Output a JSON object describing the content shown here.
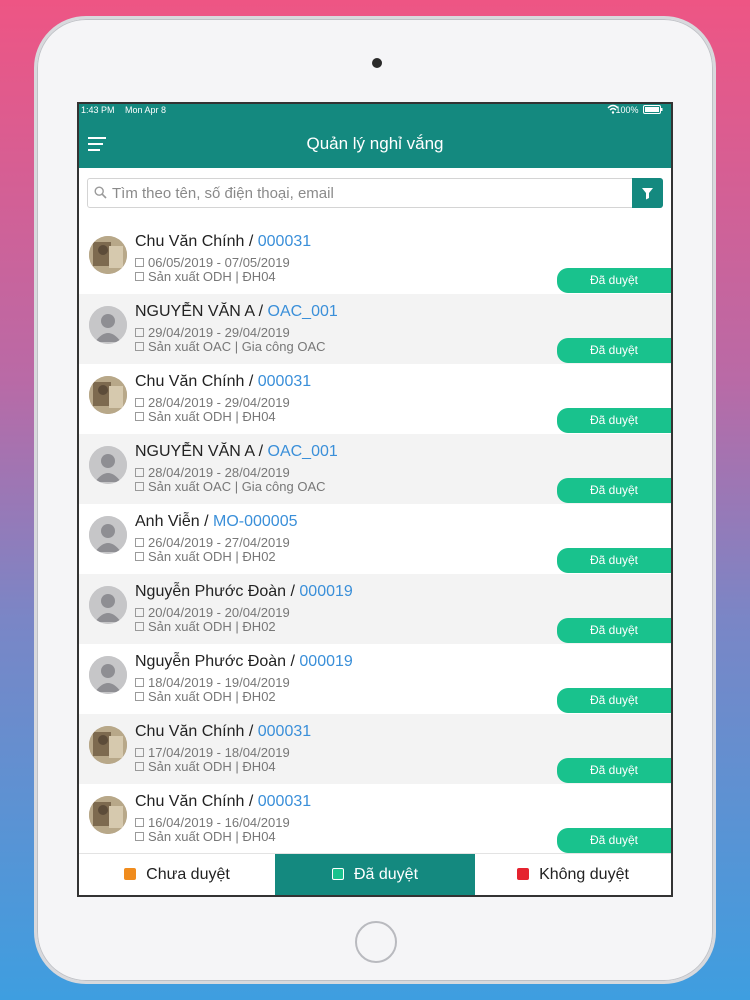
{
  "status_bar": {
    "time": "1:43 PM",
    "date": "Mon Apr 8",
    "battery": "100%"
  },
  "header": {
    "title": "Quản lý nghỉ vắng"
  },
  "search": {
    "placeholder": "Tìm theo tên, số điện thoại, email"
  },
  "leaves": [
    {
      "name": "Chu Văn Chính",
      "code": "000031",
      "dates": "06/05/2019 - 07/05/2019",
      "dept": "Sản xuất ODH | ĐH04",
      "status": "Đã duyệt",
      "avatar": "photo"
    },
    {
      "name": "NGUYỄN VĂN A",
      "code": "OAC_001",
      "dates": "29/04/2019 - 29/04/2019",
      "dept": "Sản xuất OAC | Gia công OAC",
      "status": "Đã duyệt",
      "avatar": "default"
    },
    {
      "name": "Chu Văn Chính",
      "code": "000031",
      "dates": "28/04/2019 - 29/04/2019",
      "dept": "Sản xuất ODH | ĐH04",
      "status": "Đã duyệt",
      "avatar": "photo"
    },
    {
      "name": "NGUYỄN VĂN A",
      "code": "OAC_001",
      "dates": "28/04/2019 - 28/04/2019",
      "dept": "Sản xuất OAC | Gia công OAC",
      "status": "Đã duyệt",
      "avatar": "default"
    },
    {
      "name": "Anh Viễn",
      "code": "MO-000005",
      "dates": "26/04/2019 - 27/04/2019",
      "dept": "Sản xuất ODH | ĐH02",
      "status": "Đã duyệt",
      "avatar": "default"
    },
    {
      "name": "Nguyễn Phước Đoàn",
      "code": "000019",
      "dates": "20/04/2019 - 20/04/2019",
      "dept": "Sản xuất ODH | ĐH02",
      "status": "Đã duyệt",
      "avatar": "default"
    },
    {
      "name": "Nguyễn Phước Đoàn",
      "code": "000019",
      "dates": "18/04/2019 - 19/04/2019",
      "dept": "Sản xuất ODH | ĐH02",
      "status": "Đã duyệt",
      "avatar": "default"
    },
    {
      "name": "Chu Văn Chính",
      "code": "000031",
      "dates": "17/04/2019 - 18/04/2019",
      "dept": "Sản xuất ODH | ĐH04",
      "status": "Đã duyệt",
      "avatar": "photo"
    },
    {
      "name": "Chu Văn Chính",
      "code": "000031",
      "dates": "16/04/2019 - 16/04/2019",
      "dept": "Sản xuất ODH | ĐH04",
      "status": "Đã duyệt",
      "avatar": "photo"
    }
  ],
  "tabs": [
    {
      "label": "Chưa duyệt",
      "icon": "pending-icon",
      "color": "#f08c1e"
    },
    {
      "label": "Đã duyệt",
      "icon": "approved-icon",
      "color": "#19c28d",
      "active": true
    },
    {
      "label": "Không duyệt",
      "icon": "rejected-icon",
      "color": "#e5232f"
    }
  ],
  "colors": {
    "primary": "#14897f",
    "badge": "#19c28d",
    "code": "#3a8fd9"
  }
}
